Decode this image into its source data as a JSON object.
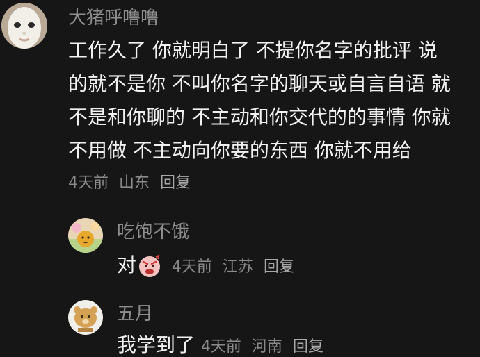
{
  "comments": [
    {
      "username": "大猪呼噜噜",
      "lines": [
        "工作久了 你就明白了 不提你名字的批评 说",
        "的就不是你 不叫你名字的聊天或自言自语 就",
        "不是和你聊的 不主动和你交代的的事情 你就",
        "不用做 不主动向你要的东西 你就不用给"
      ],
      "time": "4天前",
      "location": "山东",
      "reply_label": "回复"
    }
  ],
  "replies": [
    {
      "username": "吃饱不饿",
      "text": "对",
      "emoji": "angry-face-emoji",
      "time": "4天前",
      "location": "江苏",
      "reply_label": "回复"
    },
    {
      "username": "五月",
      "text": "我学到了",
      "time": "4天前",
      "location": "河南",
      "reply_label": "回复"
    }
  ],
  "colors": {
    "background": "#161616",
    "username": "#8d8d8d",
    "text": "#f1f1f1",
    "meta": "#8a8a8a"
  }
}
